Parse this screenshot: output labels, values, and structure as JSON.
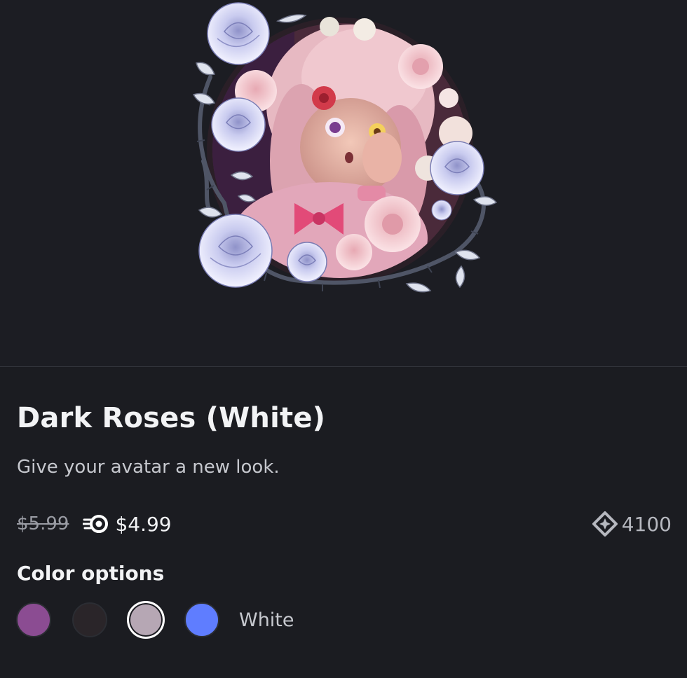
{
  "product": {
    "title": "Dark Roses (White)",
    "description": "Give your avatar a new look.",
    "original_price": "$5.99",
    "nitro_price": "$4.99",
    "orb_price": "4100"
  },
  "color_options": {
    "label": "Color options",
    "selected_name": "White",
    "swatches": [
      {
        "name": "purple",
        "color": "#8b4c92",
        "selected": false
      },
      {
        "name": "dark",
        "color": "#2a2529",
        "selected": false
      },
      {
        "name": "white",
        "color": "#b6a7b4",
        "selected": true
      },
      {
        "name": "blue",
        "color": "#5f7dff",
        "selected": false
      }
    ]
  },
  "icons": {
    "nitro": "nitro-icon",
    "orb": "orb-icon"
  },
  "colors": {
    "background": "#1b1c21",
    "text_primary": "#f2f3f5",
    "text_secondary": "#c6c8ce",
    "text_muted": "#9a9ca4"
  }
}
